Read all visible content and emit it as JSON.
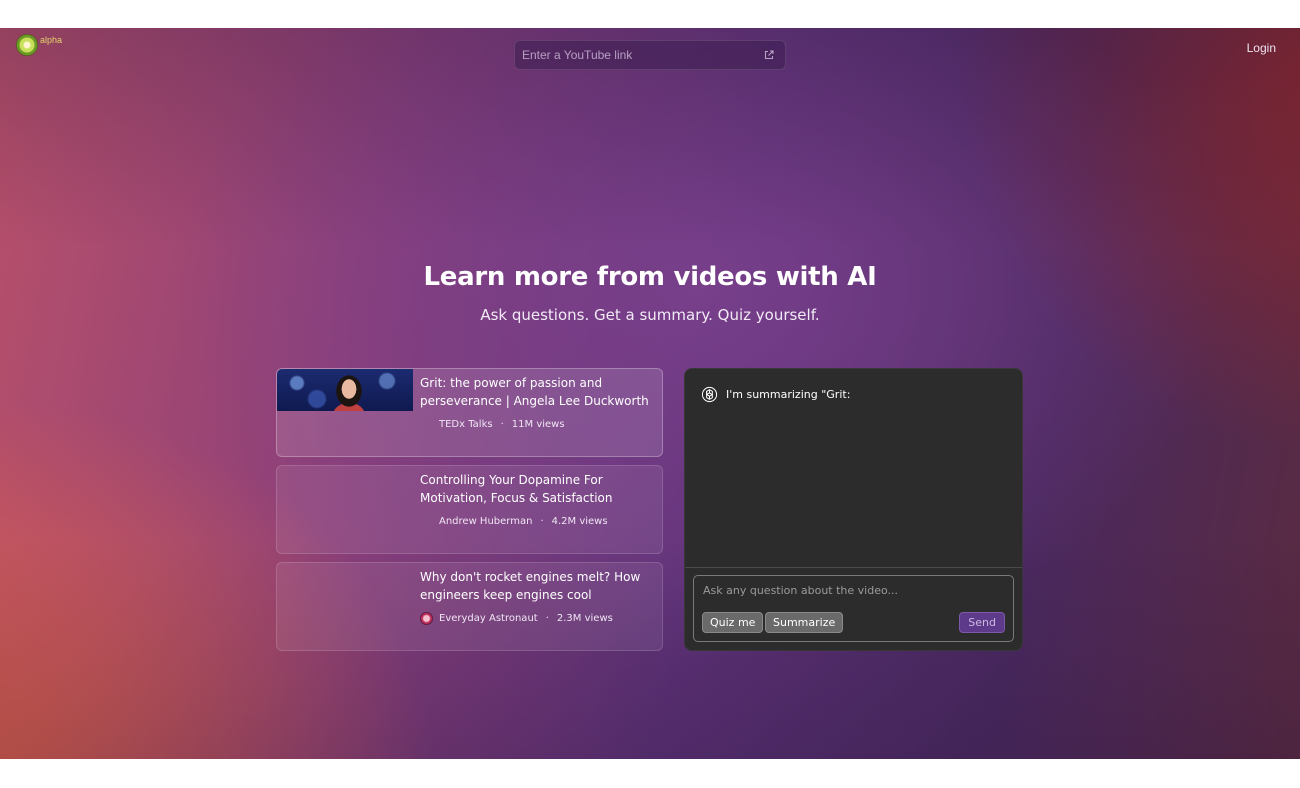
{
  "header": {
    "logo_badge": "alpha",
    "search_placeholder": "Enter a YouTube link",
    "login_label": "Login"
  },
  "hero": {
    "title": "Learn more from videos with AI",
    "subtitle": "Ask questions. Get a summary. Quiz yourself."
  },
  "videos": [
    {
      "title": "Grit: the power of passion and perseverance | Angela Lee Duckworth",
      "channel": "TEDx Talks",
      "views": "11M views",
      "separator": "·"
    },
    {
      "title": "Controlling Your Dopamine For Motivation, Focus & Satisfaction",
      "channel": "Andrew Huberman",
      "views": "4.2M views",
      "separator": "·"
    },
    {
      "title": "Why don't rocket engines melt? How engineers keep engines cool",
      "channel": "Everyday Astronaut",
      "views": "2.3M views",
      "separator": "·"
    }
  ],
  "chat": {
    "message": "I'm summarizing \"Grit:",
    "input_placeholder": "Ask any question about the video...",
    "quiz_label": "Quiz me",
    "summarize_label": "Summarize",
    "send_label": "Send"
  },
  "colors": {
    "chat_panel": "#2c2c2c",
    "send_button": "#5e3a8a",
    "chip": "#6a6a6a"
  },
  "icons": [
    "kiwi-logo-icon",
    "external-link-icon",
    "openai-icon"
  ]
}
